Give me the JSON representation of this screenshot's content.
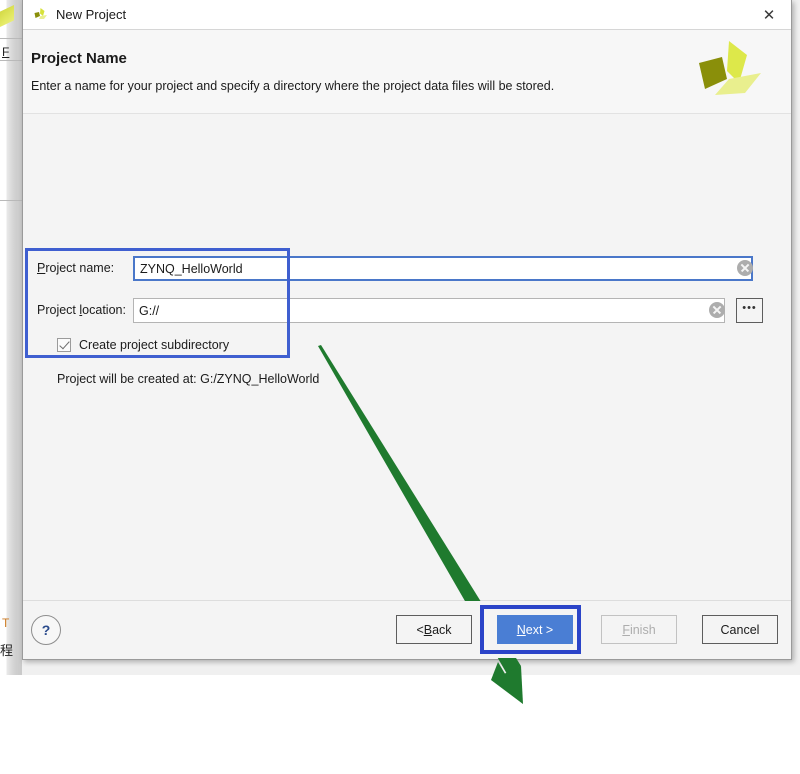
{
  "background": {
    "menu_f": "F",
    "letter_t": "T",
    "cjk_fragment": "程"
  },
  "dialog": {
    "titlebar": {
      "icon": "vivado-logo-icon",
      "title": "New Project",
      "close_label": "✕"
    },
    "header": {
      "title": "Project Name",
      "subtitle": "Enter a name for your project and specify a directory where the project data files will be stored.",
      "logo": "xilinx-vivado-logo"
    },
    "form": {
      "project_name": {
        "label_pre": "",
        "label_accel": "P",
        "label_post": "roject name:",
        "label_full": "Project name:",
        "value": "ZYNQ_HelloWorld",
        "placeholder": "",
        "clear_icon": "clear-circle-icon",
        "focused": true
      },
      "project_location": {
        "label_full": "Project location:",
        "label_pre": "Project ",
        "label_accel": "l",
        "label_post": "ocation:",
        "value": "G://",
        "placeholder": "",
        "clear_icon": "clear-circle-icon",
        "browse_label": "•••"
      },
      "create_subdirectory": {
        "label": "Create project subdirectory",
        "checked": true
      },
      "status": "Project will be created at: G:/ZYNQ_HelloWorld"
    },
    "footer": {
      "help_label": "?",
      "back": {
        "label_pre": "< ",
        "label_accel": "B",
        "label_post": "ack",
        "label_full": "< Back",
        "enabled": true
      },
      "next": {
        "label_pre": "",
        "label_accel": "N",
        "label_post": "ext >",
        "label_full": "Next >",
        "enabled": true,
        "primary": true
      },
      "finish": {
        "label_pre": "",
        "label_accel": "F",
        "label_post": "inish",
        "label_full": "Finish",
        "enabled": false
      },
      "cancel": {
        "label_full": "Cancel",
        "enabled": true
      }
    }
  },
  "annotations": {
    "fields_highlight_color": "#3f5fd0",
    "next_highlight_color": "#2b44c8",
    "arrow_color": "#1f7a2e"
  },
  "colors": {
    "primary_button": "#4a7ed4",
    "dialog_background": "#f4f4f4",
    "titlebar_background": "#ffffff",
    "help_glyph": "#2b4b8c",
    "logo_dark": "#8a8f0a",
    "logo_mid": "#d7e23a",
    "logo_light": "#e9ef8e"
  }
}
